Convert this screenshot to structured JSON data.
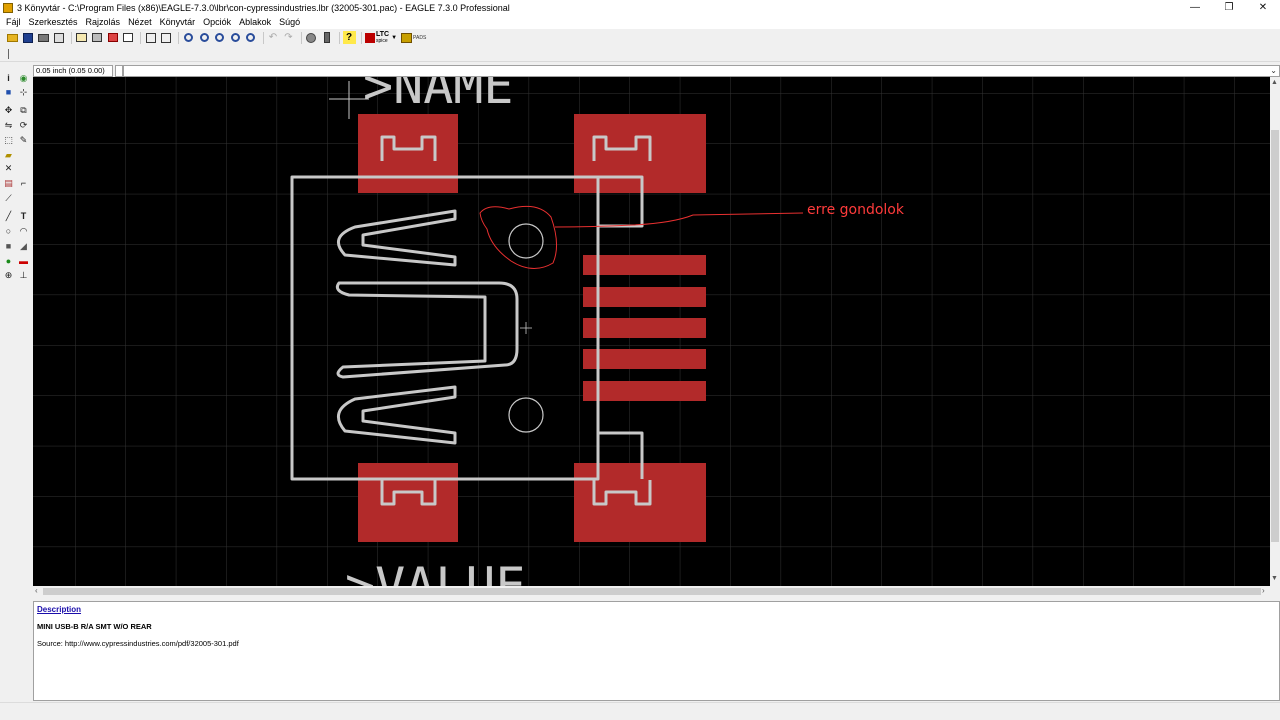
{
  "window": {
    "title": "3 Könyvtár - C:\\Program Files (x86)\\EAGLE-7.3.0\\lbr\\con-cypressindustries.lbr (32005-301.pac) - EAGLE 7.3.0 Professional",
    "minimize": "—",
    "restore": "❐",
    "close": "✕"
  },
  "menu": [
    "Fájl",
    "Szerkesztés",
    "Rajzolás",
    "Nézet",
    "Könyvtár",
    "Opciók",
    "Ablakok",
    "Súgó"
  ],
  "toolbar": {
    "ltspice_label": "LTC",
    "ltspice_sub": "spice",
    "pads_label": "PADS"
  },
  "coords": {
    "grid_readout": "0.05 inch (0.05 0.00)"
  },
  "canvas": {
    "name_label": ">NAME",
    "value_label": ">VALUE",
    "annotation_text": "erre gondolok",
    "colors": {
      "background": "#000000",
      "grid": "#3a3a3a",
      "pad": "#b22a2a",
      "outline": "#c8c8c8",
      "annotation": "#ff3b3b"
    }
  },
  "description": {
    "link": "Description",
    "title": "MINI USB-B R/A SMT W/O REAR",
    "source": "Source: http://www.cypressindustries.com/pdf/32005-301.pdf"
  }
}
